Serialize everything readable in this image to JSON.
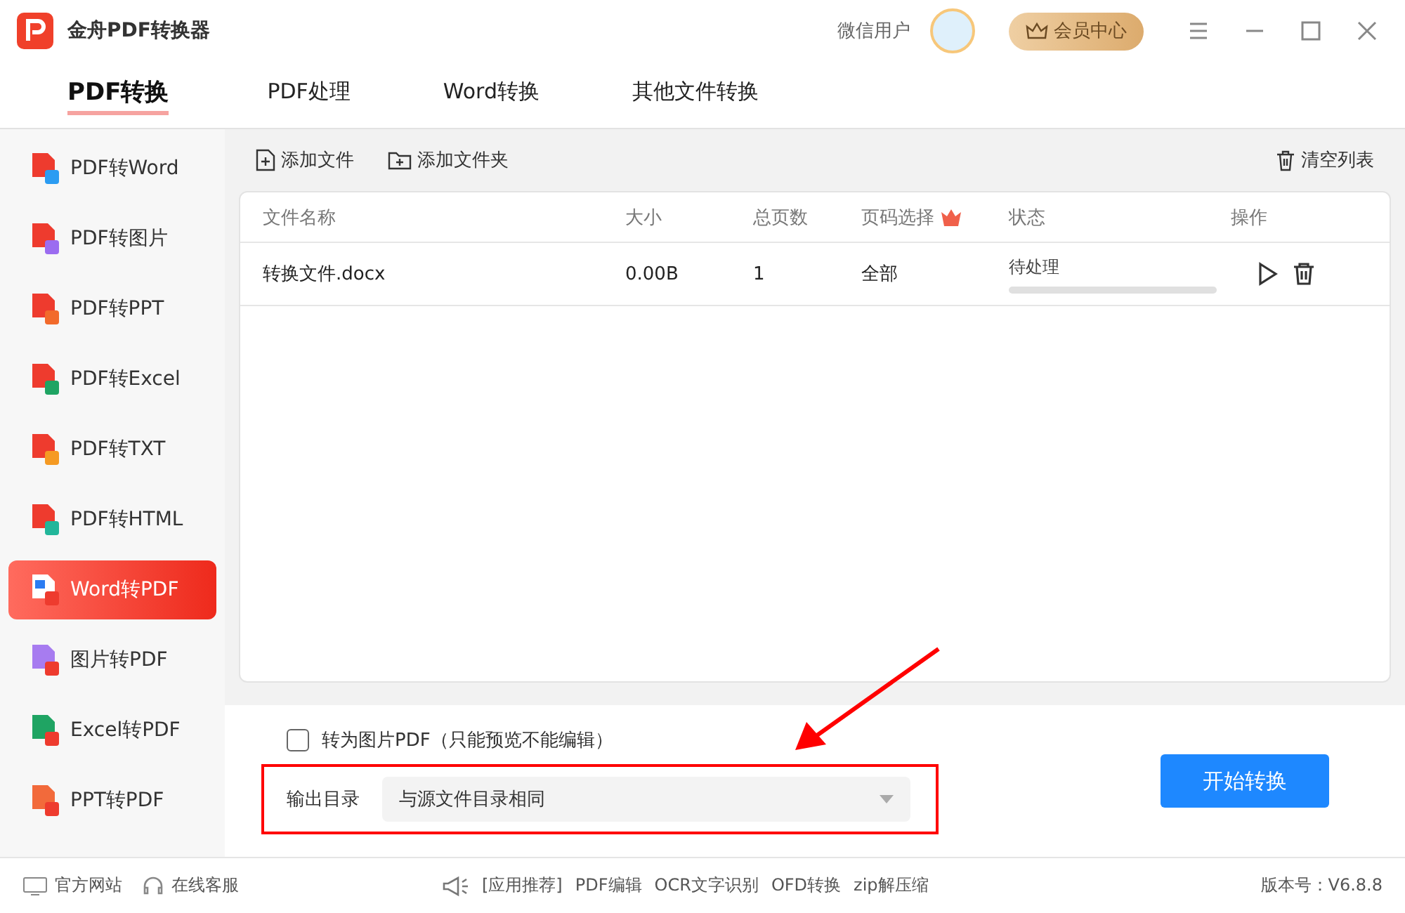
{
  "window": {
    "title": "金舟PDF转换器",
    "user": "微信用户",
    "vip_button": "会员中心"
  },
  "tabs": [
    {
      "label": "PDF转换",
      "selected": true
    },
    {
      "label": "PDF处理",
      "selected": false
    },
    {
      "label": "Word转换",
      "selected": false
    },
    {
      "label": "其他文件转换",
      "selected": false
    }
  ],
  "sidebar": {
    "items": [
      {
        "label": "PDF转Word",
        "selected": false,
        "kind": "from_pdf",
        "color": "#2b9cf2"
      },
      {
        "label": "PDF转图片",
        "selected": false,
        "kind": "from_pdf",
        "color": "#9b6cf0"
      },
      {
        "label": "PDF转PPT",
        "selected": false,
        "kind": "from_pdf",
        "color": "#f26a2b"
      },
      {
        "label": "PDF转Excel",
        "selected": false,
        "kind": "from_pdf",
        "color": "#1fa463"
      },
      {
        "label": "PDF转TXT",
        "selected": false,
        "kind": "from_pdf",
        "color": "#f59a23"
      },
      {
        "label": "PDF转HTML",
        "selected": false,
        "kind": "from_pdf",
        "color": "#22b69a"
      },
      {
        "label": "Word转PDF",
        "selected": true,
        "kind": "to_pdf",
        "color": "#2b7cf2"
      },
      {
        "label": "图片转PDF",
        "selected": false,
        "kind": "to_pdf",
        "color": "#a77cf0"
      },
      {
        "label": "Excel转PDF",
        "selected": false,
        "kind": "to_pdf",
        "color": "#1fa463"
      },
      {
        "label": "PPT转PDF",
        "selected": false,
        "kind": "to_pdf",
        "color": "#f26a3b"
      }
    ]
  },
  "toolbar": {
    "add_file": "添加文件",
    "add_folder": "添加文件夹",
    "clear": "清空列表"
  },
  "table": {
    "columns": [
      "文件名称",
      "大小",
      "总页数",
      "页码选择",
      "状态",
      "操作"
    ],
    "rows": [
      {
        "name": "转换文件.docx",
        "size": "0.00B",
        "pages": "1",
        "range": "全部",
        "status": "待处理",
        "level": 0
      }
    ]
  },
  "options": {
    "image_pdf": {
      "label": "转为图片PDF（只能预览不能编辑）",
      "checked": false
    },
    "output_label": "输出目录",
    "output_value": "与源文件目录相同",
    "start_button": "开始转换"
  },
  "status_bar": {
    "left": [
      "官方网站",
      "在线客服"
    ],
    "promo": [
      "[应用推荐]",
      "PDF编辑",
      "OCR文字识别",
      "OFD转换",
      "zip解压缩"
    ],
    "version": "版本号：V6.8.8"
  }
}
